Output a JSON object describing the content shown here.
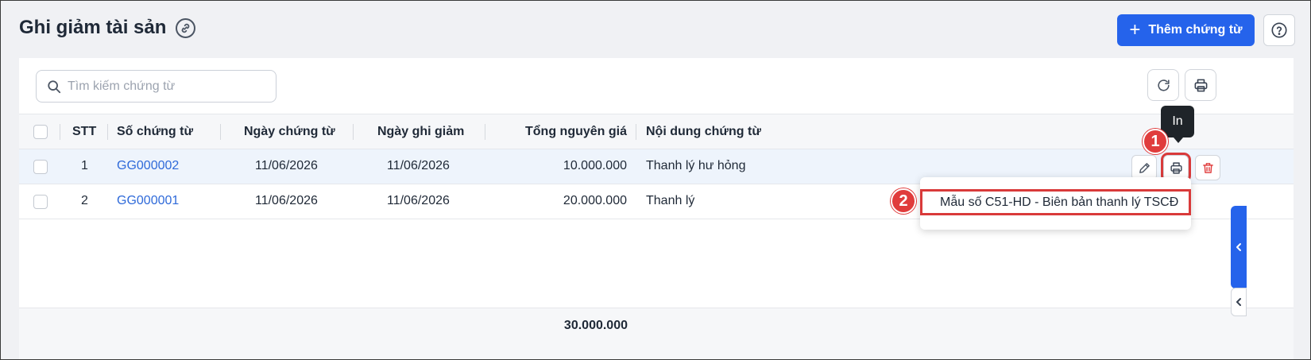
{
  "page": {
    "title": "Ghi giảm tài sản",
    "add_button_label": "Thêm chứng từ"
  },
  "search": {
    "placeholder": "Tìm kiếm chứng từ",
    "value": ""
  },
  "table": {
    "columns": [
      "STT",
      "Số chứng từ",
      "Ngày chứng từ",
      "Ngày ghi giảm",
      "Tổng nguyên giá",
      "Nội dung chứng từ"
    ],
    "rows": [
      {
        "stt": "1",
        "so_chung_tu": "GG000002",
        "ngay_chung_tu": "11/06/2026",
        "ngay_ghi_giam": "11/06/2026",
        "tong_nguyen_gia": "10.000.000",
        "noi_dung": "Thanh lý hư hỏng"
      },
      {
        "stt": "2",
        "so_chung_tu": "GG000001",
        "ngay_chung_tu": "11/06/2026",
        "ngay_ghi_giam": "11/06/2026",
        "tong_nguyen_gia": "20.000.000",
        "noi_dung": "Thanh lý"
      }
    ],
    "total": "30.000.000"
  },
  "tooltip": {
    "text": "In"
  },
  "print_menu": {
    "items": [
      "Mẫu số C51-HD - Biên bản thanh lý TSCĐ"
    ]
  },
  "annotations": {
    "step1": "1",
    "step2": "2"
  },
  "colors": {
    "primary": "#2563eb",
    "link": "#2f6ad9",
    "highlight_red": "#d93a3a",
    "delete_red": "#e03c3c"
  },
  "icons": {
    "title": "link-icon",
    "help": "question-circle-icon",
    "search": "search-icon",
    "refresh": "refresh-icon",
    "print": "printer-icon",
    "edit": "pencil-icon",
    "delete": "trash-icon",
    "collapse": "chevron-left-icon"
  }
}
